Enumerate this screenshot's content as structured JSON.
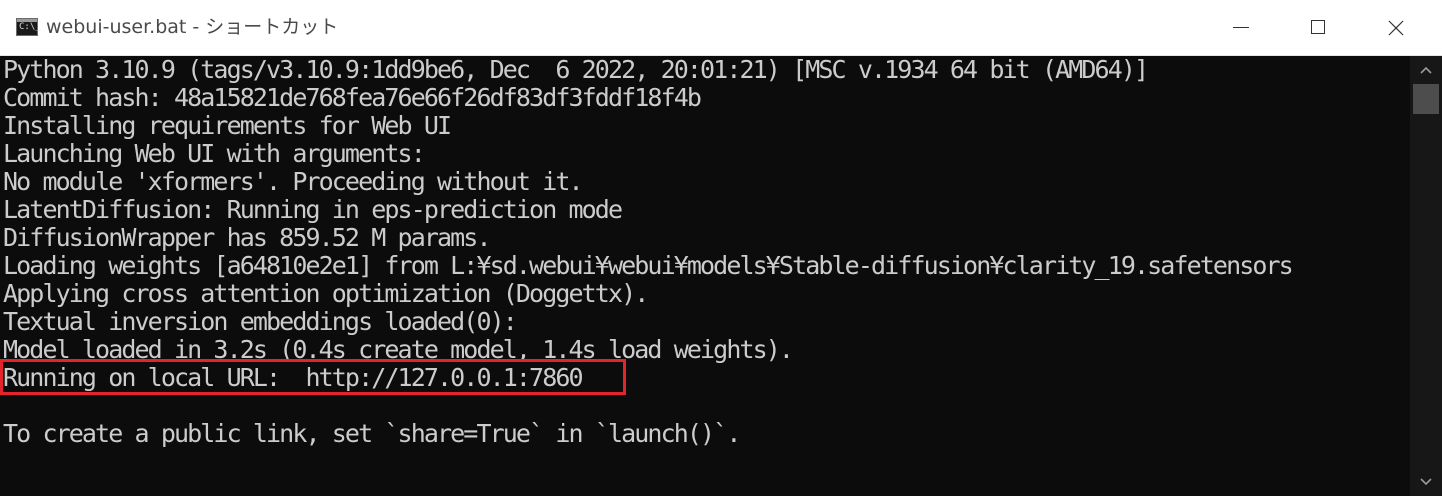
{
  "window": {
    "title": "webui-user.bat - ショートカット",
    "icon_text": "C:\\_",
    "icons": {
      "app": "console-app-icon",
      "minimize": "minimize-icon",
      "maximize": "maximize-icon",
      "close": "close-icon"
    }
  },
  "console": {
    "lines": [
      "Python 3.10.9 (tags/v3.10.9:1dd9be6, Dec  6 2022, 20:01:21) [MSC v.1934 64 bit (AMD64)]",
      "Commit hash: 48a15821de768fea76e66f26df83df3fddf18f4b",
      "Installing requirements for Web UI",
      "Launching Web UI with arguments:",
      "No module 'xformers'. Proceeding without it.",
      "LatentDiffusion: Running in eps-prediction mode",
      "DiffusionWrapper has 859.52 M params.",
      "Loading weights [a64810e2e1] from L:¥sd.webui¥webui¥models¥Stable-diffusion¥clarity_19.safetensors",
      "Applying cross attention optimization (Doggettx).",
      "Textual inversion embeddings loaded(0):",
      "Model loaded in 3.2s (0.4s create model, 1.4s load weights).",
      "Running on local URL:  http://127.0.0.1:7860",
      "",
      "To create a public link, set `share=True` in `launch()`."
    ],
    "highlight_color": "#e3242b"
  },
  "colors": {
    "console_bg": "#0c0c0c",
    "console_text": "#cccccc",
    "titlebar_bg": "#ffffff"
  }
}
